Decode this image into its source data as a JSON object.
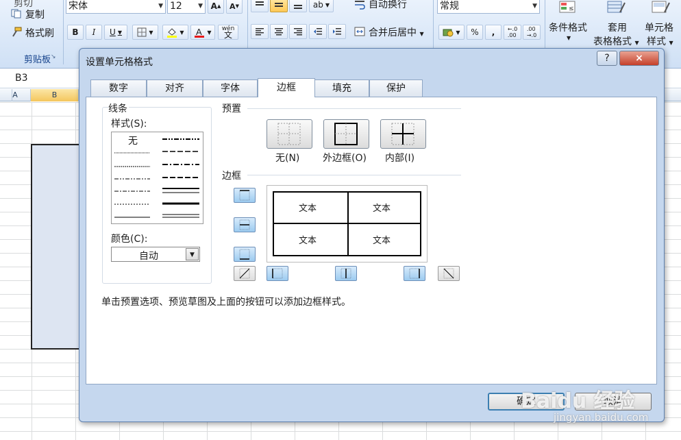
{
  "ribbon": {
    "clipboard": {
      "cut": "剪切",
      "copy": "复制",
      "format_painter": "格式刷",
      "group_label": "剪贴板"
    },
    "font": {
      "name": "宋体",
      "size": "12",
      "bold": "B",
      "italic": "I",
      "underline": "U",
      "wen": "wén"
    },
    "alignment": {
      "wrap_text": "自动换行",
      "merge_center": "合并后居中"
    },
    "number": {
      "format": "常规",
      "percent": "%",
      "comma": ","
    },
    "styles": {
      "conditional": "条件格式",
      "table_format_1": "套用",
      "table_format_2": "表格格式",
      "cell_style_1": "单元格",
      "cell_style_2": "样式"
    }
  },
  "namebox": "B3",
  "columns": [
    "A",
    "B"
  ],
  "dialog": {
    "title": "设置单元格格式",
    "help": "?",
    "close": "×",
    "tabs": [
      "数字",
      "对齐",
      "字体",
      "边框",
      "填充",
      "保护"
    ],
    "active_tab": "边框",
    "line_section": "线条",
    "style_label": "样式(S):",
    "style_none": "无",
    "color_label": "颜色(C):",
    "color_value": "自动",
    "preset_section": "预置",
    "presets": [
      "无(N)",
      "外边框(O)",
      "内部(I)"
    ],
    "border_section": "边框",
    "preview_texts": [
      "文本",
      "文本",
      "文本",
      "文本"
    ],
    "hint": "单击预置选项、预览草图及上面的按钮可以添加边框样式。",
    "ok": "确定",
    "cancel": "取消"
  },
  "watermark": {
    "brand": "Baidu 经验",
    "url": "jingyan.baidu.com"
  }
}
